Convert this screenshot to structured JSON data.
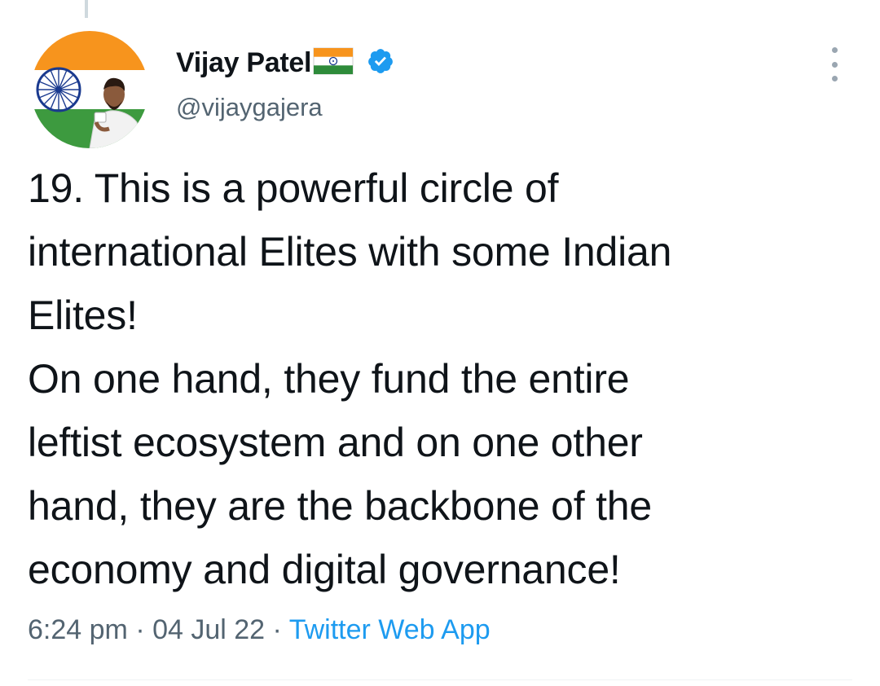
{
  "tweet": {
    "author": {
      "display_name": "Vijay Patel",
      "handle": "@vijaygajera",
      "verified": true,
      "name_emoji": "india-flag-icon"
    },
    "text_lines": [
      "19. This is a powerful circle of",
      "international Elites with some Indian",
      "Elites!",
      "On one hand, they fund the entire",
      "leftist ecosystem and on one other",
      "hand, they are the backbone of the",
      "economy and digital governance!"
    ],
    "meta": {
      "time": "6:24 pm",
      "separator": "·",
      "date": "04 Jul 22",
      "source": "Twitter Web App"
    }
  },
  "colors": {
    "text": "#0f1419",
    "secondary": "#536471",
    "accent": "#1d9bf0",
    "saffron": "#f7941d",
    "green": "#2e8b3a",
    "chakra": "#1a3a8f"
  }
}
